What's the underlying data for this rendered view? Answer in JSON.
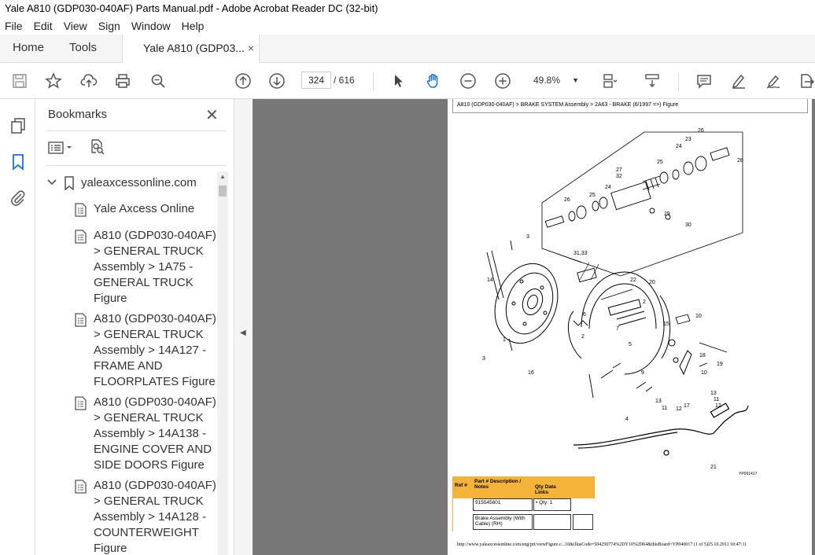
{
  "window": {
    "title": "Yale A810 (GDP030-040AF) Parts Manual.pdf - Adobe Acrobat Reader DC (32-bit)"
  },
  "menu": [
    "File",
    "Edit",
    "View",
    "Sign",
    "Window",
    "Help"
  ],
  "tabs": {
    "home": "Home",
    "tools": "Tools",
    "doc": "Yale A810 (GDP03...",
    "close": "×"
  },
  "toolbar": {
    "page_current": "324",
    "page_total": "/ 616",
    "zoom": "49.8%",
    "zoom_caret": "▼"
  },
  "bookmarks": {
    "title": "Bookmarks",
    "close": "✕",
    "root": {
      "chevron": "⌄",
      "label": "yaleaxcessonline.com"
    },
    "items": [
      "Yale Axcess Online",
      "A810 (GDP030-040AF) > GENERAL TRUCK Assembly > 1A75 - GENERAL TRUCK Figure",
      "A810 (GDP030-040AF) > GENERAL TRUCK Assembly > 14A127 - FRAME AND FLOORPLATES Figure",
      "A810 (GDP030-040AF) > GENERAL TRUCK Assembly > 14A138 - ENGINE COVER AND SIDE DOORS Figure",
      "A810 (GDP030-040AF) > GENERAL TRUCK Assembly > 14A128 - COUNTERWEIGHT Figure"
    ]
  },
  "splitter_arrow": "◀",
  "document": {
    "breadcrumb": "A810 (GDP030-040AF) > BRAKE SYSTEM Assembly > 2A63 - BRAKE (6/1997 =>) Figure",
    "figure_code": "YP091417",
    "callouts": [
      "26",
      "23",
      "24",
      "28",
      "25",
      "27",
      "32",
      "24",
      "25",
      "29",
      "30",
      "26",
      "3",
      "31,33",
      "22",
      "20",
      "14",
      "6",
      "2",
      "7",
      "2",
      "15",
      "10",
      "1",
      "5",
      "18",
      "19",
      "3",
      "9",
      "10",
      "16",
      "13",
      "11",
      "12",
      "13",
      "11",
      "12",
      "17",
      "4",
      "21",
      "8"
    ],
    "table": {
      "headers": {
        "ref": "Ref #",
        "part": "Part # Description / Notes",
        "qty": "Qty Data Links"
      },
      "part_number": "915545601",
      "qty": "• Qty: 1",
      "description": "Brake Assembly (With Cable) (RH)"
    },
    "footer_url": "http://www.yaleaxcessonline.com/eng/prt/viewFigure.c...10&illusCode=504250774%2DY10%2D04&thisBoard=YP040017 (1 of 5)25.10.2011 10:47:11"
  }
}
